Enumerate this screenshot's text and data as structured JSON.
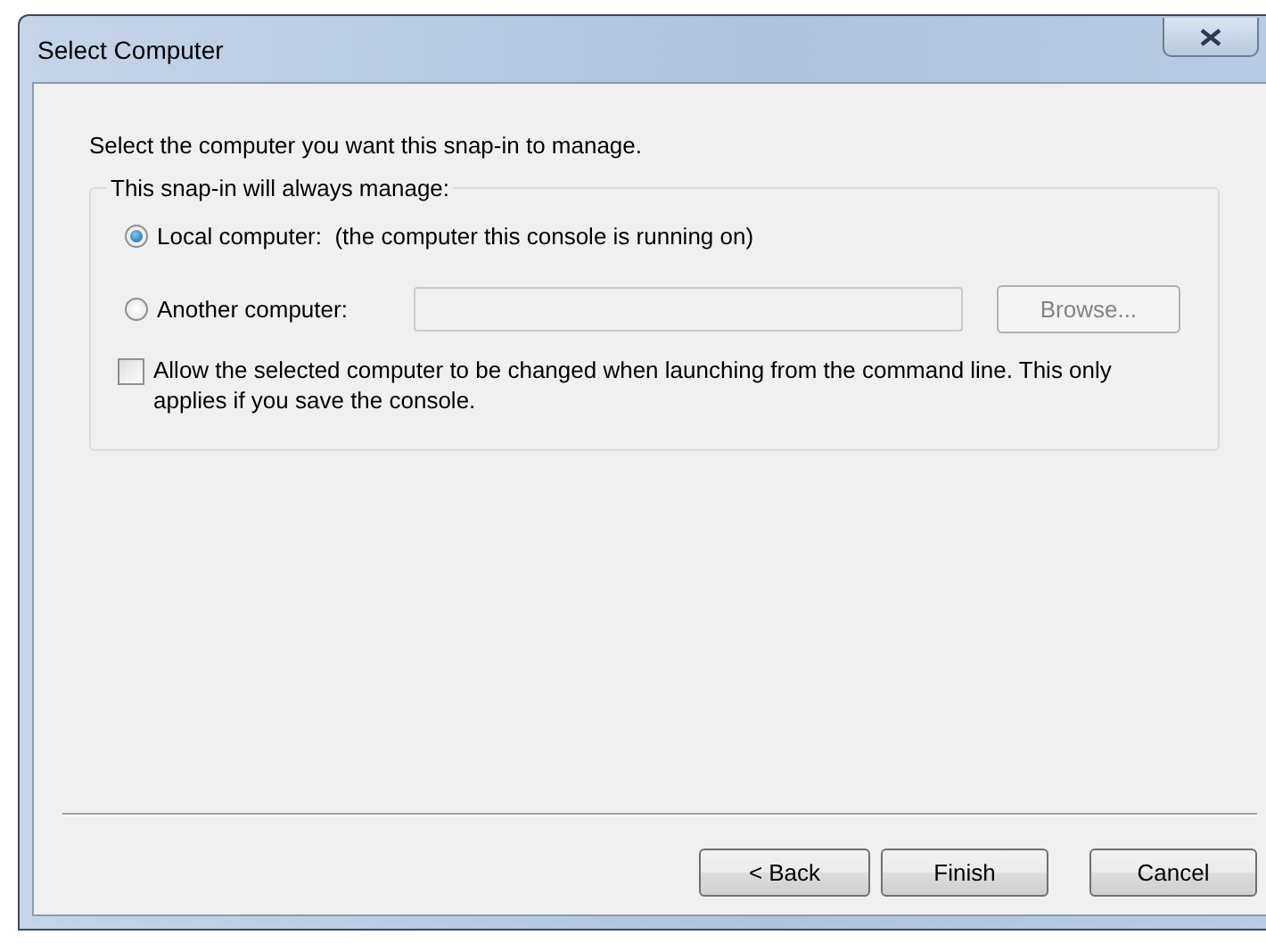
{
  "window": {
    "title": "Select Computer"
  },
  "instruction": "Select the computer you want this snap-in to manage.",
  "group": {
    "legend": "This snap-in will always manage:",
    "options": [
      {
        "label": "Local computer:  (the computer this console is running on)",
        "selected": true
      },
      {
        "label": "Another computer:",
        "selected": false,
        "field": {
          "disabled": true
        },
        "button": {
          "label": "Browse...",
          "disabled": true
        }
      }
    ],
    "checkbox": {
      "label": "Allow the selected computer to be changed when launching from the command line.  This only applies if you save the console.",
      "checked": false
    }
  },
  "buttons": [
    {
      "label": "< Back"
    },
    {
      "label": "Finish"
    },
    {
      "label": "Cancel"
    }
  ]
}
